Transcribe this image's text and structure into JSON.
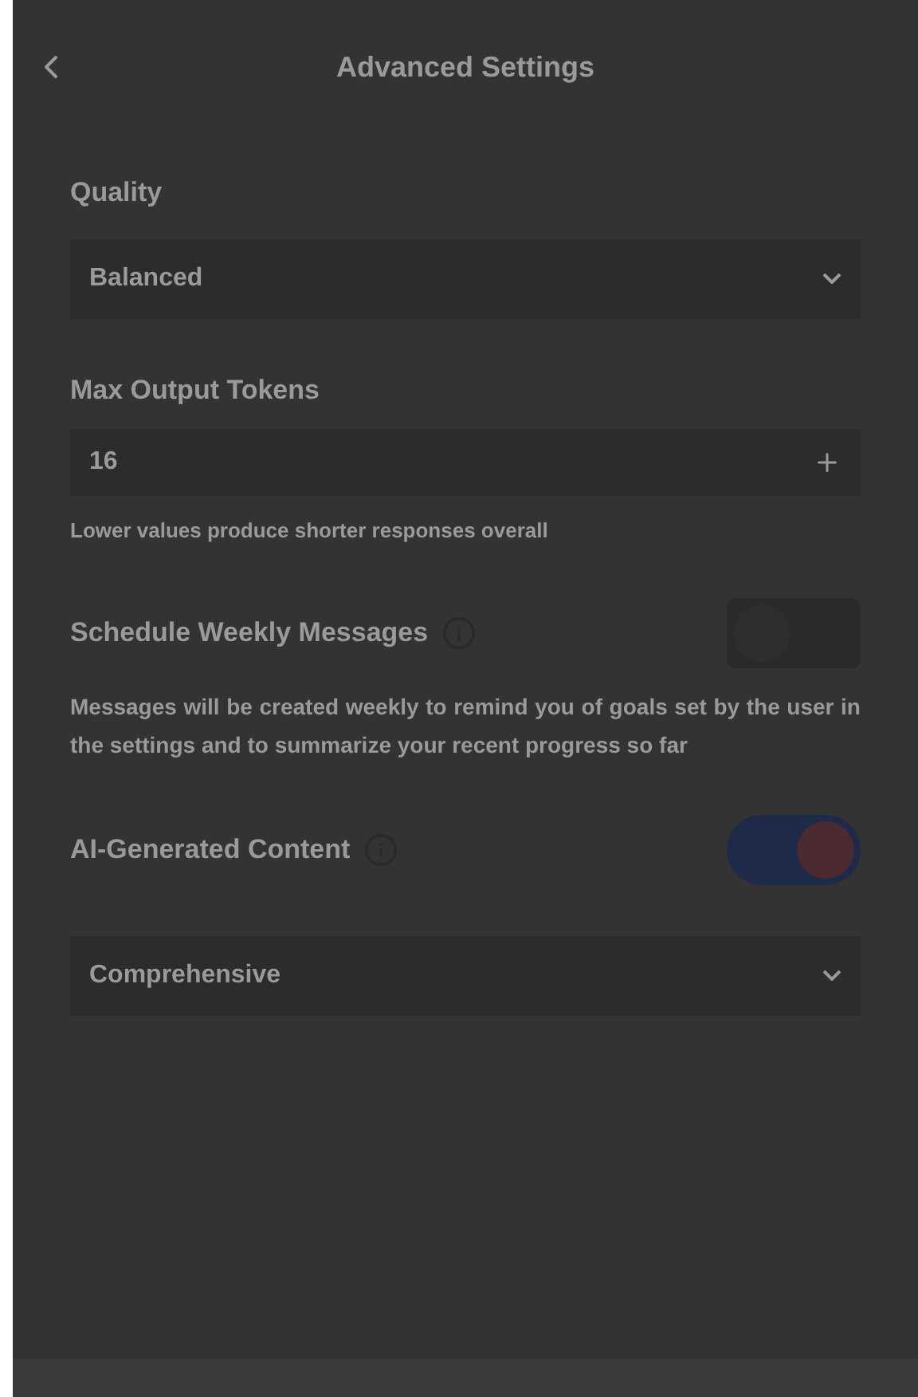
{
  "header": {
    "title": "Advanced Settings"
  },
  "sections": [
    {
      "kind": "select",
      "label": "Quality",
      "value": "Balanced"
    },
    {
      "kind": "stepper",
      "label": "Max Output Tokens",
      "value": "16",
      "help": "Lower values produce shorter responses overall"
    },
    {
      "kind": "toggle",
      "label": "Schedule Weekly Messages",
      "on": false,
      "description": "Messages will be created weekly to remind you of goals set by the user in the settings and to summarize your recent progress so far"
    },
    {
      "kind": "toggle",
      "label": "AI-Generated Content",
      "on": true
    },
    {
      "kind": "select",
      "value": "Comprehensive"
    }
  ]
}
